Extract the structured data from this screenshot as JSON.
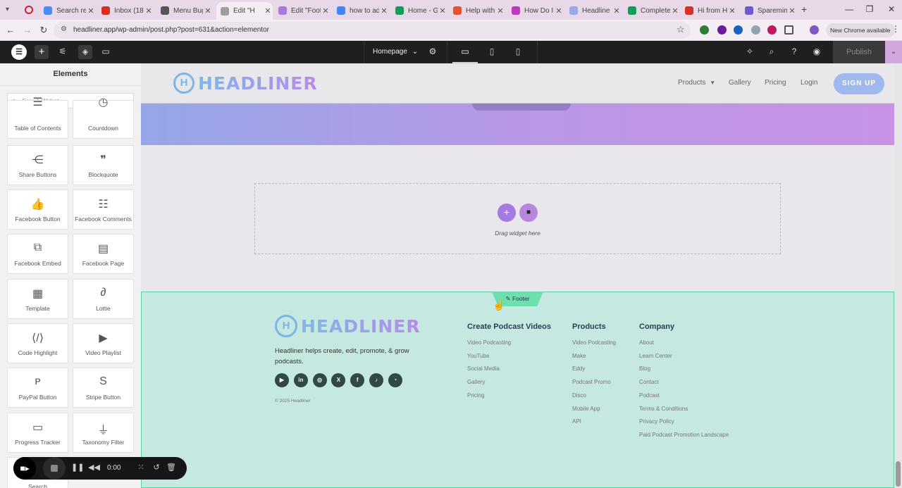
{
  "browser": {
    "tabs": [
      {
        "title": "Search re",
        "color": "#4b8bf5"
      },
      {
        "title": "Inbox (18",
        "color": "#d93025"
      },
      {
        "title": "Menu Bug",
        "color": "#555555"
      },
      {
        "title": "Edit \"H",
        "color": "#9e9e9e",
        "active": true
      },
      {
        "title": "Edit \"Foot",
        "color": "#a57be0"
      },
      {
        "title": "how to ad",
        "color": "#4285f4"
      },
      {
        "title": "Home - G",
        "color": "#0f9d58"
      },
      {
        "title": "Help with",
        "color": "#e6522c"
      },
      {
        "title": "How Do I",
        "color": "#c038c0"
      },
      {
        "title": "Headline",
        "color": "#9aa7e8"
      },
      {
        "title": "Complete",
        "color": "#0f9d58"
      },
      {
        "title": "Hi from H",
        "color": "#d93025"
      },
      {
        "title": "Sparemin",
        "color": "#6a5acd"
      }
    ],
    "url": "headliner.app/wp-admin/post.php?post=631&action=elementor",
    "new_chrome_label": "New Chrome available"
  },
  "editor": {
    "page_name": "Homepage",
    "publish_label": "Publish"
  },
  "panel": {
    "title": "Elements",
    "search_placeholder": "Search Widget...",
    "widgets": [
      {
        "label": "Table of Contents",
        "icon": "list-icon"
      },
      {
        "label": "Countdown",
        "icon": "timer-icon"
      },
      {
        "label": "Share Buttons",
        "icon": "share-icon"
      },
      {
        "label": "Blockquote",
        "icon": "quote-icon"
      },
      {
        "label": "Facebook Button",
        "icon": "thumbs-up-icon"
      },
      {
        "label": "Facebook Comments",
        "icon": "comments-icon"
      },
      {
        "label": "Facebook Embed",
        "icon": "embed-icon"
      },
      {
        "label": "Facebook Page",
        "icon": "page-icon"
      },
      {
        "label": "Template",
        "icon": "template-icon"
      },
      {
        "label": "Lottie",
        "icon": "lottie-icon"
      },
      {
        "label": "Code Highlight",
        "icon": "code-icon"
      },
      {
        "label": "Video Playlist",
        "icon": "playlist-icon"
      },
      {
        "label": "PayPal Button",
        "icon": "paypal-icon"
      },
      {
        "label": "Stripe Button",
        "icon": "stripe-icon"
      },
      {
        "label": "Progress Tracker",
        "icon": "progress-icon"
      },
      {
        "label": "Taxonomy Filter",
        "icon": "filter-icon"
      },
      {
        "label": "Search",
        "icon": "search-icon"
      }
    ]
  },
  "site": {
    "logo_text": "HEADLINER",
    "logo_letter": "H",
    "nav": {
      "products": "Products",
      "gallery": "Gallery",
      "pricing": "Pricing",
      "login": "Login",
      "signup": "SIGN UP"
    },
    "dropzone_text": "Drag widget here"
  },
  "footer": {
    "tab_label": "Footer",
    "logo_text": "HEADLINER",
    "logo_letter": "H",
    "description": "Headliner helps create, edit, promote, & grow podcasts.",
    "copyright": "© 2025 Headliner",
    "social": [
      "youtube-icon",
      "linkedin-icon",
      "instagram-icon",
      "x-icon",
      "facebook-icon",
      "tiktok-icon",
      "rss-icon"
    ],
    "columns": [
      {
        "heading": "Create Podcast Videos",
        "links": [
          "Video Podcasting",
          "YouTube",
          "Social Media",
          "Gallery",
          "Pricing"
        ]
      },
      {
        "heading": "Products",
        "links": [
          "Video Podcasting",
          "Make",
          "Eddy",
          "Podcast Promo",
          "Disco",
          "Mobile App",
          "API"
        ]
      },
      {
        "heading": "Company",
        "links": [
          "About",
          "Learn Center",
          "Blog",
          "Contact",
          "Podcast",
          "Terms & Conditions",
          "Privacy Policy",
          "Paid Podcast Promotion Landscape"
        ]
      }
    ]
  },
  "recorder": {
    "time": "0:00"
  }
}
